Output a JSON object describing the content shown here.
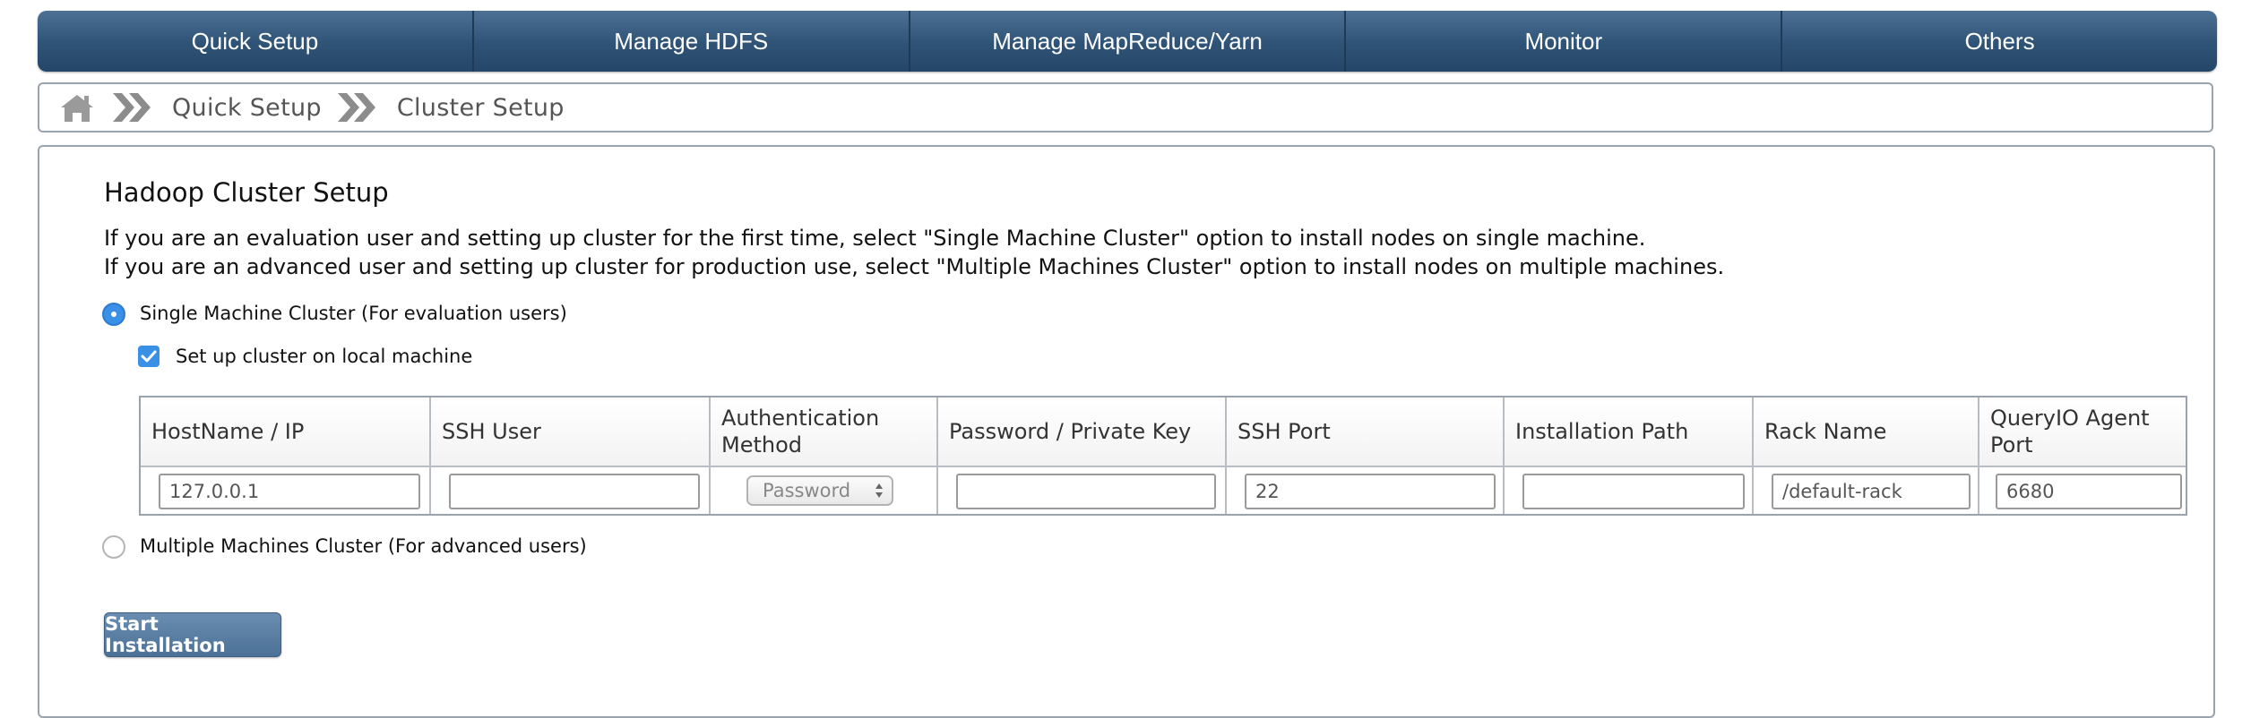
{
  "nav": {
    "items": [
      {
        "label": "Quick Setup"
      },
      {
        "label": "Manage HDFS"
      },
      {
        "label": "Manage MapReduce/Yarn"
      },
      {
        "label": "Monitor"
      },
      {
        "label": "Others"
      }
    ]
  },
  "breadcrumb": {
    "home_icon": "home-icon",
    "separator_icon": "double-chevron-right-icon",
    "items": [
      "Quick Setup",
      "Cluster Setup"
    ]
  },
  "setup": {
    "title": "Hadoop Cluster Setup",
    "description": [
      "If you are an evaluation user and setting up cluster for the first time, select \"Single Machine Cluster\" option to install nodes on single machine.",
      "If you are an advanced user and setting up cluster for production use, select \"Multiple Machines Cluster\" option to install nodes on multiple machines."
    ],
    "options": {
      "single": {
        "label": "Single Machine Cluster (For evaluation users)",
        "selected": true
      },
      "local": {
        "label": "Set up cluster on local machine",
        "checked": true
      },
      "multiple": {
        "label": "Multiple Machines Cluster (For advanced users)",
        "selected": false
      }
    },
    "table": {
      "headers": [
        "HostName / IP",
        "SSH User",
        "Authentication Method",
        "Password / Private Key",
        "SSH Port",
        "Installation Path",
        "Rack Name",
        "QueryIO Agent Port"
      ],
      "row": {
        "hostname": "127.0.0.1",
        "ssh_user": "",
        "auth_method": "Password",
        "password": "",
        "ssh_port": "22",
        "install_path": "",
        "rack_name": "/default-rack",
        "agent_port": "6680"
      }
    },
    "start_button": "Start Installation"
  },
  "colors": {
    "nav_bar": "#2f5376",
    "accent": "#3a8fe6",
    "button": "#4c7196"
  }
}
